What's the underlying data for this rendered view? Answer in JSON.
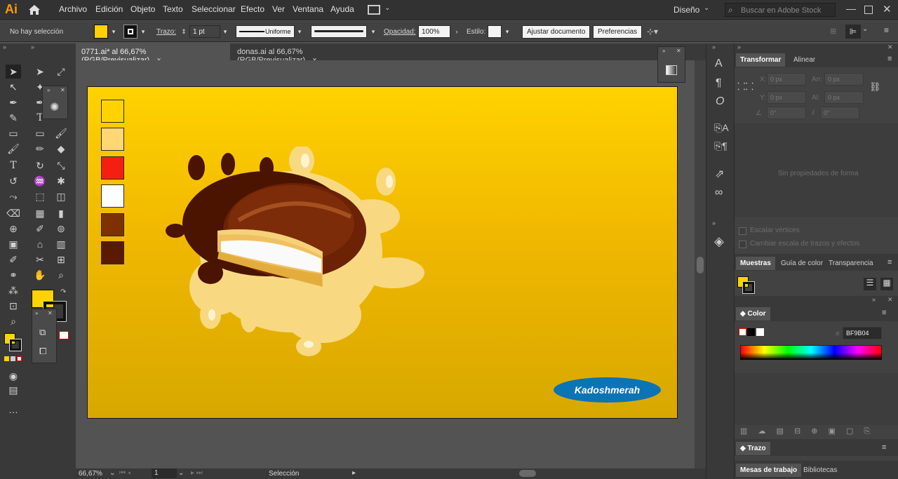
{
  "app": {
    "logo": "Ai"
  },
  "menu": [
    "Archivo",
    "Edición",
    "Objeto",
    "Texto",
    "Seleccionar",
    "Efecto",
    "Ver",
    "Ventana",
    "Ayuda"
  ],
  "workspace": {
    "label": "Diseño"
  },
  "search": {
    "placeholder": "Buscar en Adobe Stock"
  },
  "control": {
    "selection_status": "No hay selección",
    "stroke_label": "Trazo:",
    "stroke_value": "1 pt",
    "profile": "Uniforme",
    "opacity_label": "Opacidad:",
    "opacity_value": "100%",
    "style_label": "Estilo:",
    "adjust_doc": "Ajustar documento",
    "preferences": "Preferencias"
  },
  "tabs": [
    {
      "label": "0771.ai* al 66,67% (RGB/Previsualizar)",
      "close": "×"
    },
    {
      "label": "donas.ai al 66,67% (RGB/Previsualizar)",
      "close": "×"
    }
  ],
  "artboard": {
    "badge_text": "Kadoshmerah",
    "swatches": [
      "#ffd200",
      "#ffd774",
      "#f51f11",
      "#ffffff",
      "#7d3100",
      "#5a1a00"
    ]
  },
  "status": {
    "zoom": "66,67%",
    "artboard_num": "1",
    "tool": "Selección"
  },
  "panels": {
    "transform_tabs": [
      "Transformar",
      "Alinear"
    ],
    "x_label": "X:",
    "x_value": "0 px",
    "y_label": "Y:",
    "y_value": "0 px",
    "w_label": "An:",
    "w_value": "0 px",
    "h_label": "Al:",
    "h_value": "0 px",
    "rot_value": "0°",
    "shear_value": "0°",
    "no_shape": "Sin propiedades de forma",
    "scale_corners": "Escalar vértices",
    "scale_strokes": "Cambiar escala de trazos y efectos",
    "swatch_tabs": [
      "Muestras",
      "Guía de color",
      "Transparencia"
    ],
    "color_title": "Color",
    "hex_label": "#",
    "hex_value": "BF9B04",
    "stroke_title": "Trazo",
    "bottom_tabs": [
      "Mesas de trabajo",
      "Bibliotecas"
    ]
  },
  "colors": {
    "fill": "#ffd200",
    "accent_blue": "#0b74b5"
  }
}
